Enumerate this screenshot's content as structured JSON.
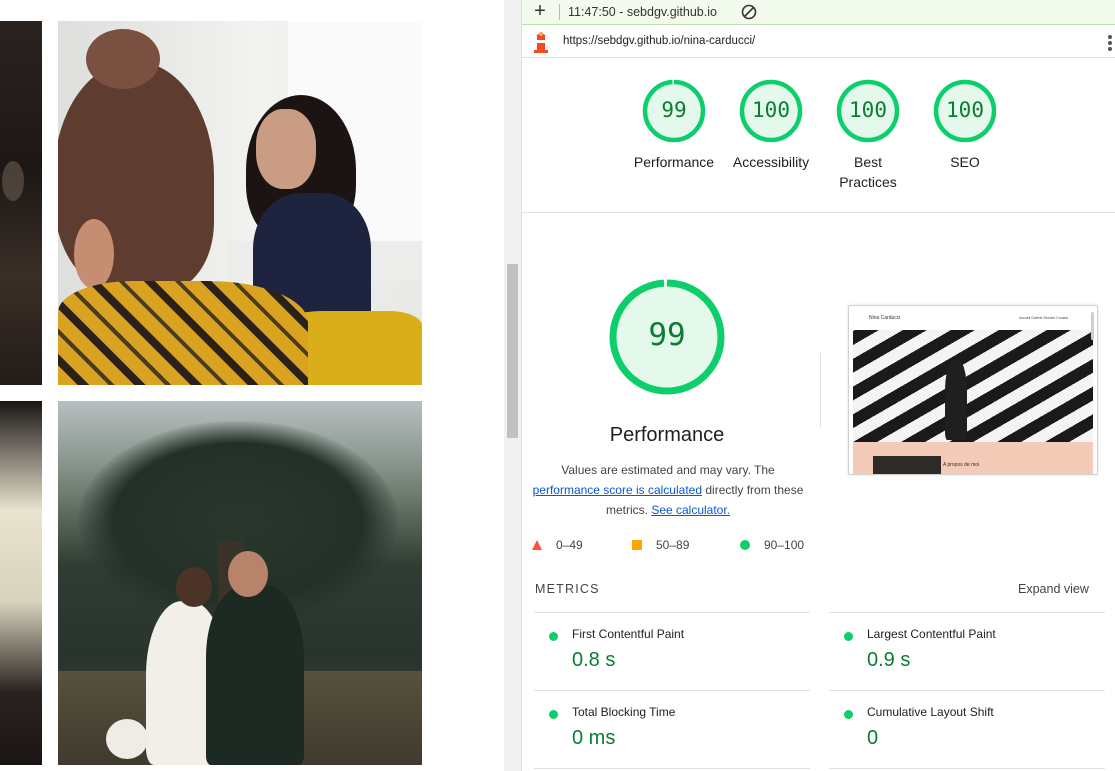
{
  "toolbar": {
    "new_report_icon": "plus-icon",
    "report_time_host": "11:47:50 - sebdgv.github.io",
    "clear_icon": "block-icon"
  },
  "url_bar": {
    "url": "https://sebdgv.github.io/nina-carducci/",
    "more_icon": "vertical-dots-icon"
  },
  "summary_gauges": [
    {
      "score": "99",
      "label": "Performance",
      "percent": 99
    },
    {
      "score": "100",
      "label": "Accessibility",
      "percent": 100
    },
    {
      "score": "100",
      "label_line1": "Best",
      "label_line2": "Practices",
      "percent": 100
    },
    {
      "score": "100",
      "label": "SEO",
      "percent": 100
    }
  ],
  "performance": {
    "score": "99",
    "percent": 99,
    "title": "Performance",
    "desc_prefix": "Values are estimated and may vary. The",
    "desc_link": "performance score is calculated",
    "desc_middle": "directly from these metrics.",
    "calculator_link": "See calculator."
  },
  "legend": {
    "fail": "0–49",
    "average": "50–89",
    "pass": "90–100"
  },
  "screenshot": {
    "brand": "Nina Carducci",
    "nav": "Accueil   Galerie   Service   Contact",
    "about": "A propos de moi"
  },
  "metrics": {
    "heading": "METRICS",
    "expand": "Expand view",
    "items": [
      {
        "name": "First Contentful Paint",
        "value": "0.8 s"
      },
      {
        "name": "Largest Contentful Paint",
        "value": "0.9 s"
      },
      {
        "name": "Total Blocking Time",
        "value": "0 ms"
      },
      {
        "name": "Cumulative Layout Shift",
        "value": "0"
      }
    ]
  },
  "colors": {
    "pass": "#0cce6b",
    "pass_text": "#0a7d32",
    "average": "#ffa400",
    "fail": "#ff4e42",
    "link": "#0b57d0"
  }
}
